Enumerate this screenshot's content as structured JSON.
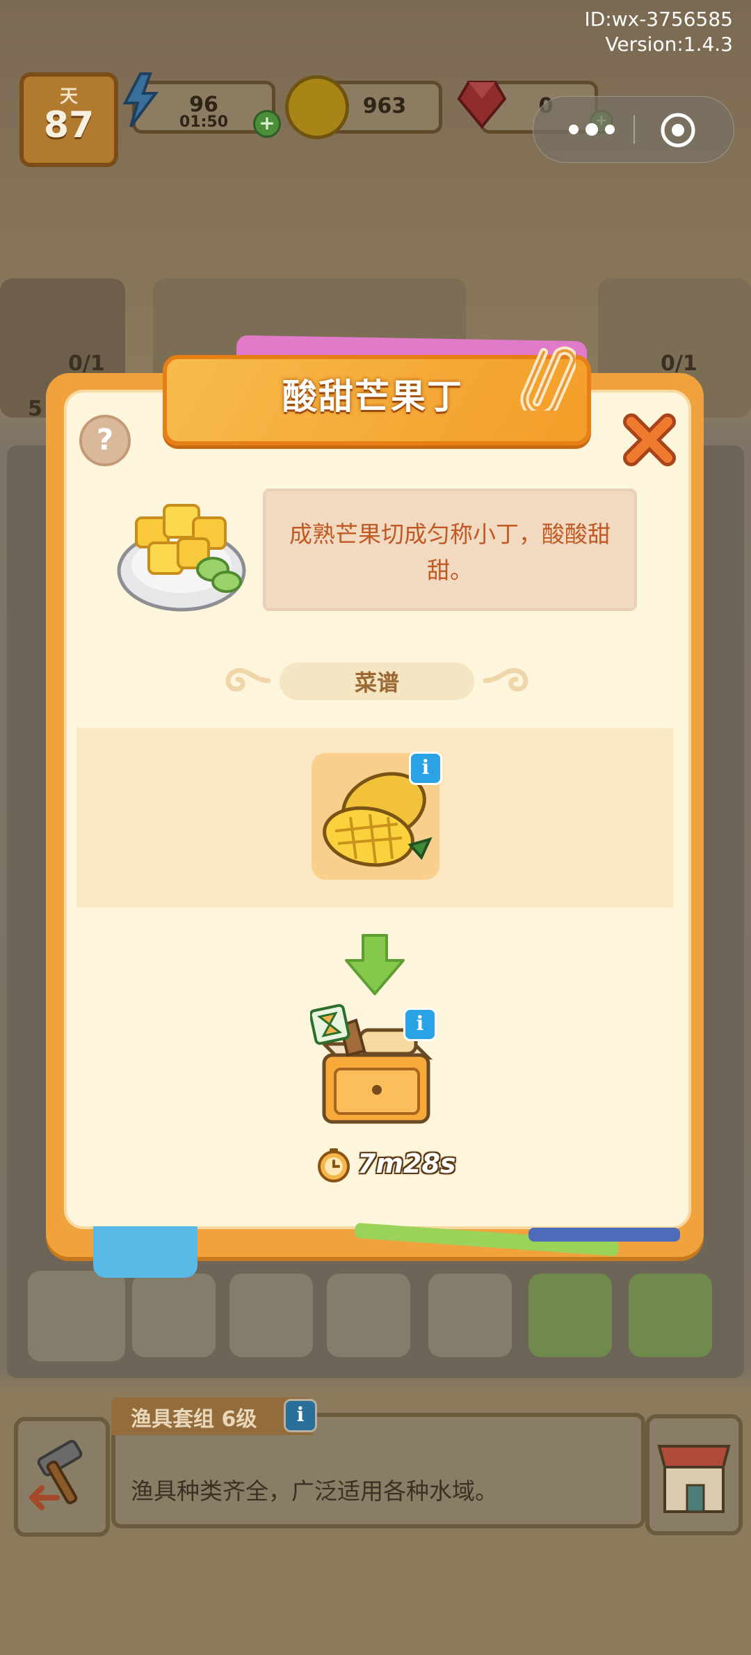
{
  "system": {
    "id_line": "ID:wx-3756585",
    "version_line": "Version:1.4.3"
  },
  "hud": {
    "day_label": "天",
    "day_value": "87",
    "energy_value": "96",
    "energy_timer": "01:50",
    "gold_value": "963",
    "gem_value": "0"
  },
  "background_counters": {
    "left": "0/1",
    "right": "0/1",
    "side": "5"
  },
  "modal": {
    "title": "酸甜芒果丁",
    "help_label": "?",
    "description": "成熟芒果切成匀称小丁，酸酸甜甜。",
    "recipe_label": "菜谱",
    "ingredient_info": "i",
    "station_info": "i",
    "cook_time": "7m28s"
  },
  "bottom": {
    "item_title": "渔具套组 6级",
    "item_info": "i",
    "item_description": "渔具种类齐全，广泛适用各种水域。"
  },
  "icons": [
    "energy-icon",
    "gold-coin-icon",
    "ruby-gem-icon",
    "more-dots-icon",
    "close-miniprogram-icon",
    "paperclip-icon",
    "close-x-icon",
    "mango-dice-dish-icon",
    "mango-icon",
    "arrow-down-icon",
    "cutting-board-station-icon",
    "hourglass-icon",
    "timer-icon",
    "hammer-icon",
    "shop-icon"
  ],
  "colors": {
    "modal_orange": "#f0a33c",
    "title_text": "#ffffff",
    "desc_text": "#c05a22",
    "info_blue": "#2aa3e6",
    "arrow_green": "#7cc242"
  }
}
